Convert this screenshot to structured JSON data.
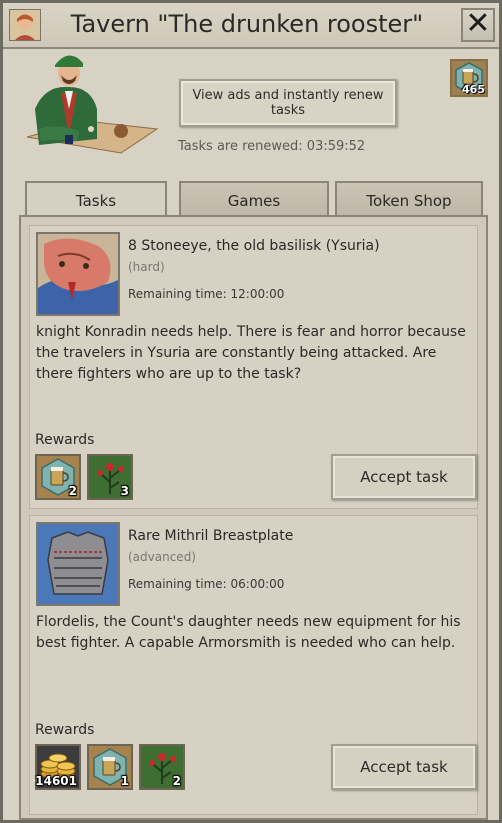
{
  "window": {
    "title": "Tavern \"The drunken rooster\""
  },
  "header": {
    "ad_button_label": "View ads and instantly renew tasks",
    "renew_label": "Tasks are renewed: 03:59:52",
    "token_count": "465"
  },
  "tabs": [
    {
      "label": "Tasks",
      "active": true
    },
    {
      "label": "Games",
      "active": false
    },
    {
      "label": "Token Shop",
      "active": false
    }
  ],
  "quests": [
    {
      "title": "8 Stoneeye, the old basilisk (Ysuria)",
      "difficulty": "(hard)",
      "remaining": "Remaining time: 12:00:00",
      "description": "knight Konradin needs help. There is fear and horror because the travelers in Ysuria are constantly being attacked. Are there fighters who are up to the task?",
      "rewards_label": "Rewards",
      "rewards": [
        {
          "icon": "beer-token-icon",
          "count": "2"
        },
        {
          "icon": "rose-herb-icon",
          "count": "3"
        }
      ],
      "accept_label": "Accept task"
    },
    {
      "title": "Rare Mithril Breastplate",
      "difficulty": "(advanced)",
      "remaining": "Remaining time: 06:00:00",
      "description": "Flordelis, the Count's daughter needs new equipment for his best fighter. A capable Armorsmith is needed who can help.",
      "rewards_label": "Rewards",
      "rewards": [
        {
          "icon": "gold-coins-icon",
          "count": "14601"
        },
        {
          "icon": "beer-token-icon",
          "count": "1"
        },
        {
          "icon": "rose-herb-icon",
          "count": "2"
        }
      ],
      "accept_label": "Accept task"
    }
  ],
  "colors": {
    "panel": "#d8d2c4",
    "border": "#8b8579",
    "token_teal": "#7fb3b0",
    "herb_green": "#3f6e33"
  }
}
